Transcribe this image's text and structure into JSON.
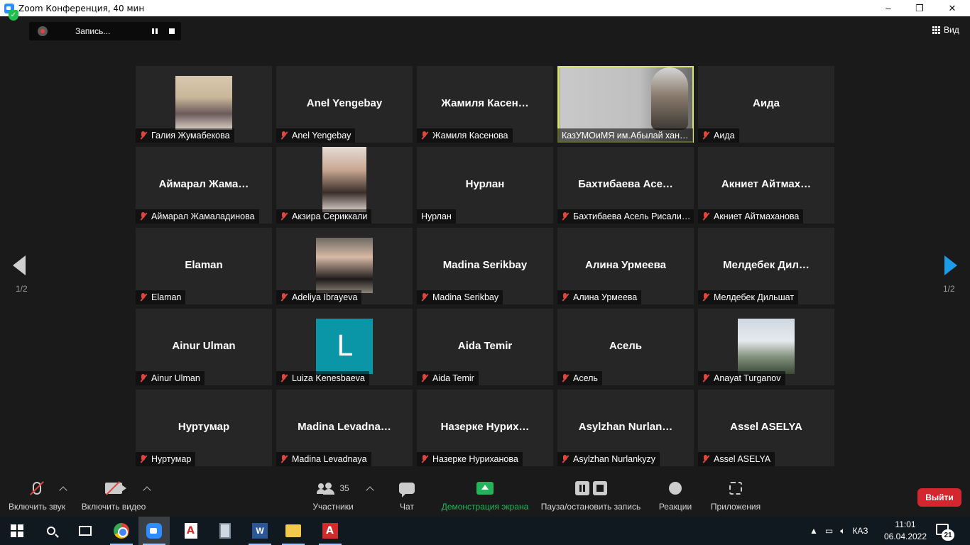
{
  "window": {
    "title": "Zoom Конференция, 40 мин",
    "minimize": "–",
    "restore": "❐",
    "close": "✕"
  },
  "topbar": {
    "recording_label": "Запись...",
    "view_label": "Вид"
  },
  "gallery": {
    "page_left": "1/2",
    "page_right": "1/2",
    "tiles": [
      {
        "display": "",
        "name": "Галия Жумабекова",
        "muted": true,
        "media": "photo",
        "photo": "ph1"
      },
      {
        "display": "Anel Yengebay",
        "name": "Anel Yengebay",
        "muted": true,
        "media": "name"
      },
      {
        "display": "Жамиля  Касен…",
        "name": "Жамиля Касенова",
        "muted": true,
        "media": "name"
      },
      {
        "display": "",
        "name": "КазУМОиМЯ им.Абылай хан…",
        "muted": false,
        "media": "camera",
        "active": true
      },
      {
        "display": "Аида",
        "name": "Аида",
        "muted": true,
        "media": "name"
      },
      {
        "display": "Аймарал  Жама…",
        "name": "Аймарал Жамаладинова",
        "muted": true,
        "media": "name"
      },
      {
        "display": "",
        "name": "Акзира Сериккали",
        "muted": true,
        "media": "photo",
        "photo": "ph2"
      },
      {
        "display": "Нурлан",
        "name": "Нурлан",
        "muted": false,
        "media": "name"
      },
      {
        "display": "Бахтибаева  Асе…",
        "name": "Бахтибаева Асель Рисали…",
        "muted": true,
        "media": "name"
      },
      {
        "display": "Акниет  Айтмах…",
        "name": "Акниет Айтмаханова",
        "muted": true,
        "media": "name"
      },
      {
        "display": "Elaman",
        "name": "Elaman",
        "muted": true,
        "media": "name"
      },
      {
        "display": "",
        "name": "Adeliya Ibrayeva",
        "muted": true,
        "media": "photo",
        "photo": "ph3"
      },
      {
        "display": "Madina Serikbay",
        "name": "Madina Serikbay",
        "muted": true,
        "media": "name"
      },
      {
        "display": "Алина Урмеева",
        "name": "Алина Урмеева",
        "muted": true,
        "media": "name"
      },
      {
        "display": "Мелдебек  Дил…",
        "name": "Мелдебек Дильшат",
        "muted": true,
        "media": "name"
      },
      {
        "display": "Ainur Ulman",
        "name": "Ainur Ulman",
        "muted": true,
        "media": "name"
      },
      {
        "display": "L",
        "name": "Luiza Kenesbaeva",
        "muted": true,
        "media": "initial",
        "photo": "ph4"
      },
      {
        "display": "Aida Temir",
        "name": "Aida Temir",
        "muted": true,
        "media": "name"
      },
      {
        "display": "Асель",
        "name": "Асель",
        "muted": true,
        "media": "name"
      },
      {
        "display": "",
        "name": "Anayat Turganov",
        "muted": true,
        "media": "photo",
        "photo": "ph5"
      },
      {
        "display": "Нуртумар",
        "name": "Нуртумар",
        "muted": true,
        "media": "name"
      },
      {
        "display": "Madina  Levadna…",
        "name": "Madina Levadnaya",
        "muted": true,
        "media": "name"
      },
      {
        "display": "Назерке  Нурих…",
        "name": "Назерке Нуриханова",
        "muted": true,
        "media": "name"
      },
      {
        "display": "Asylzhan  Nurlan…",
        "name": "Asylzhan Nurlankyzy",
        "muted": true,
        "media": "name"
      },
      {
        "display": "Assel ASELYA",
        "name": "Assel ASELYA",
        "muted": true,
        "media": "name"
      }
    ]
  },
  "toolbar": {
    "unmute": "Включить звук",
    "start_video": "Включить видео",
    "participants": "Участники",
    "participants_count": "35",
    "chat": "Чат",
    "share": "Демонстрация экрана",
    "pause_record": "Пауза/остановить запись",
    "reactions": "Реакции",
    "apps": "Приложения",
    "leave": "Выйти",
    "share_color": "#23b45b",
    "leave_color": "#d4262e"
  },
  "taskbar": {
    "lang": "КАЗ",
    "time": "11:01",
    "date": "06.04.2022",
    "notifications": "21",
    "word_letter": "W"
  }
}
